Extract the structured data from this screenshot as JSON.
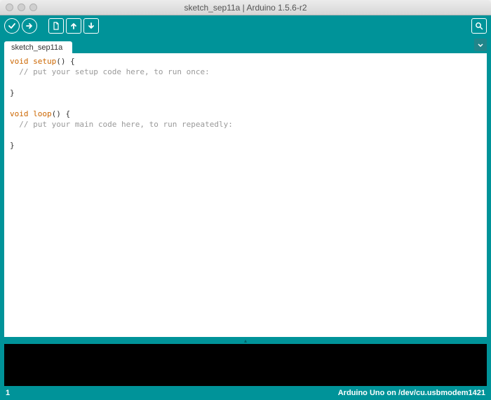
{
  "window": {
    "title": "sketch_sep11a | Arduino 1.5.6-r2"
  },
  "tab": {
    "name": "sketch_sep11a"
  },
  "code": {
    "l1a": "void",
    "l1b": " ",
    "l1c": "setup",
    "l1d": "() {",
    "l2": "  // put your setup code here, to run once:",
    "l3": "",
    "l4": "}",
    "l5": "",
    "l6a": "void",
    "l6b": " ",
    "l6c": "loop",
    "l6d": "() {",
    "l7": "  // put your main code here, to run repeatedly:",
    "l8": "",
    "l9": "}"
  },
  "status": {
    "line": "1",
    "board": "Arduino Uno on /dev/cu.usbmodem1421"
  },
  "colors": {
    "teal": "#009399"
  }
}
